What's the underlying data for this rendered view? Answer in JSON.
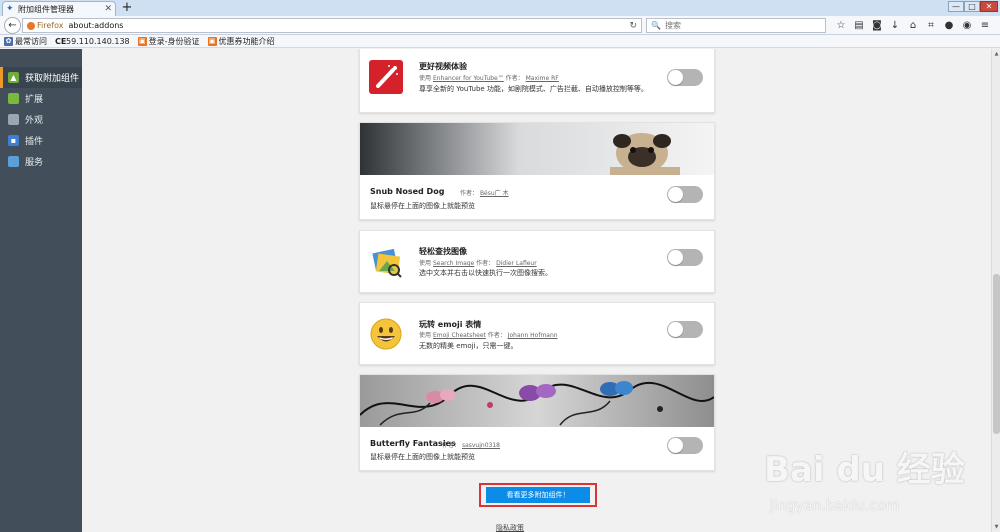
{
  "window": {
    "tab_title": "附加组件管理器",
    "min_label": "—",
    "max_label": "□",
    "close_label": "✕"
  },
  "nav": {
    "identity_label": "Firefox",
    "url": "about:addons",
    "search_placeholder": "搜索"
  },
  "bookmarks": [
    {
      "label": "最常访问",
      "icon": "gear-icon"
    },
    {
      "label": "59.110.140.138",
      "icon": "ce-icon"
    },
    {
      "label": "登录-身份验证",
      "icon": "orange-bookmark-icon"
    },
    {
      "label": "优惠券功能介绍",
      "icon": "orange-bookmark-icon"
    }
  ],
  "sidebar": {
    "items": [
      {
        "label": "获取附加组件",
        "icon": "get-addons-icon",
        "active": true
      },
      {
        "label": "扩展",
        "icon": "puzzle-icon"
      },
      {
        "label": "外观",
        "icon": "theme-icon"
      },
      {
        "label": "插件",
        "icon": "plugin-icon"
      },
      {
        "label": "服务",
        "icon": "services-icon"
      }
    ]
  },
  "addons": [
    {
      "title": "更好视频体验",
      "meta_prefix": "使用",
      "meta_name": "Enhancer for YouTube™",
      "meta_author_label": "作者：",
      "meta_author": "Maxime RF",
      "desc": "尊享全新的 YouTube 功能，如剧院模式、广告拦截、自动播放控制等等。",
      "enabled": false
    },
    {
      "title": "Snub Nosed Dog",
      "meta_author_label": "作者：",
      "meta_author": "Bésu广 木",
      "desc": "鼠标悬停在上面的图像上就能预览",
      "enabled": false
    },
    {
      "title": "轻松查找图像",
      "meta_prefix": "使用",
      "meta_name": "Search Image",
      "meta_author_label": "作者：",
      "meta_author": "Didier Lafleur",
      "desc": "选中文本并右击以快速执行一次图像搜索。",
      "enabled": false
    },
    {
      "title": "玩转 emoji 表情",
      "meta_prefix": "使用",
      "meta_name": "Emoji Cheatsheet",
      "meta_author_label": "作者：",
      "meta_author": "Johann Hofmann",
      "desc": "无数的精美 emoji，只需一键。",
      "enabled": false
    },
    {
      "title": "Butterfly Fantasies",
      "meta_author_label": "作者：",
      "meta_author": "sasvujn0318",
      "desc": "鼠标悬停在上面的图像上就能预览",
      "enabled": false
    }
  ],
  "footer": {
    "more_button": "看看更多附加组件！",
    "privacy_link": "隐私政策"
  },
  "watermark": {
    "logo_text": "Bai du 经验",
    "url_text": "jingyan.baidu.com"
  },
  "colors": {
    "sidebar_bg": "#424f5a",
    "active_accent": "#ee9a2a",
    "button_blue": "#0c8ce9",
    "highlight_red": "#d8343a"
  }
}
